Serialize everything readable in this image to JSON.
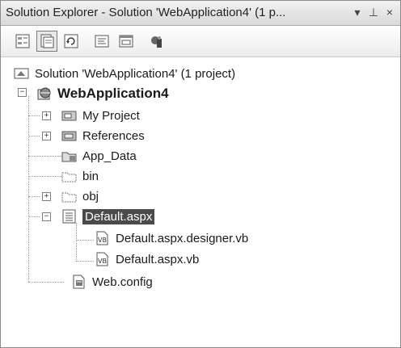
{
  "window": {
    "title": "Solution Explorer - Solution 'WebApplication4' (1 p...",
    "buttons": {
      "dropdown": "▾",
      "pin": "⊥",
      "close": "×"
    }
  },
  "toolbar": {
    "tools": [
      {
        "name": "properties-icon",
        "pressed": false
      },
      {
        "name": "show-all-files-icon",
        "pressed": true
      },
      {
        "name": "refresh-icon",
        "pressed": false
      },
      {
        "name": "view-code-icon",
        "pressed": false
      },
      {
        "name": "view-designer-icon",
        "pressed": false
      },
      {
        "name": "copy-website-icon",
        "pressed": false
      }
    ]
  },
  "tree": {
    "solution": "Solution 'WebApplication4' (1 project)",
    "project": "WebApplication4",
    "items": [
      {
        "label": "My Project",
        "icon": "my-project-icon"
      },
      {
        "label": "References",
        "icon": "references-icon"
      },
      {
        "label": "App_Data",
        "icon": "folder-icon"
      },
      {
        "label": "bin",
        "icon": "folder-outline-icon"
      },
      {
        "label": "obj",
        "icon": "folder-outline-icon"
      },
      {
        "label": "Default.aspx",
        "icon": "aspx-page-icon"
      },
      {
        "label": "Default.aspx.designer.vb",
        "icon": "vb-file-icon"
      },
      {
        "label": "Default.aspx.vb",
        "icon": "vb-file-icon"
      },
      {
        "label": "Web.config",
        "icon": "config-file-icon"
      }
    ],
    "expanders": {
      "collapsed": "+",
      "expanded": "−"
    }
  }
}
